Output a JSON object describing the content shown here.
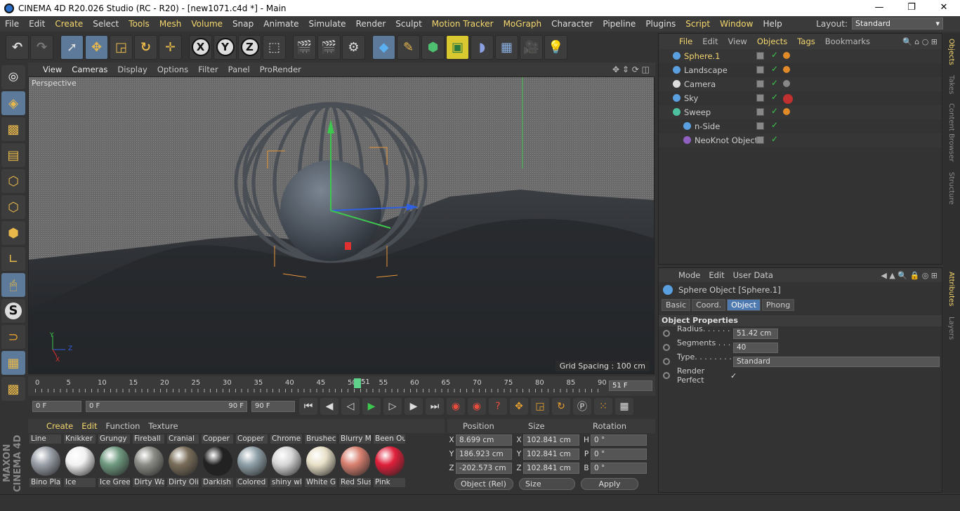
{
  "window": {
    "title": "CINEMA 4D R20.026 Studio (RC - R20) - [new1071.c4d *] - Main"
  },
  "menu": [
    "File",
    "Edit",
    "Create",
    "Select",
    "Tools",
    "Mesh",
    "Volume",
    "Snap",
    "Animate",
    "Simulate",
    "Render",
    "Sculpt",
    "Motion Tracker",
    "MoGraph",
    "Character",
    "Pipeline",
    "Plugins",
    "Script",
    "Window",
    "Help"
  ],
  "layout": {
    "label": "Layout:",
    "value": "Standard"
  },
  "toolbar": {
    "x": "X",
    "y": "Y",
    "z": "Z"
  },
  "viewport": {
    "menu": [
      "View",
      "Cameras",
      "Display",
      "Options",
      "Filter",
      "Panel",
      "ProRender"
    ],
    "label": "Perspective",
    "grid_spacing": "Grid Spacing : 100 cm",
    "axis_x": "X",
    "axis_y": "Y",
    "axis_z": "Z"
  },
  "timeline": {
    "ticks": [
      "0",
      "5",
      "10",
      "15",
      "20",
      "25",
      "30",
      "35",
      "40",
      "45",
      "50",
      "55",
      "60",
      "65",
      "70",
      "75",
      "80",
      "85",
      "90"
    ],
    "current": "51",
    "current_field": "51 F",
    "start": "0 F",
    "range_start": "0 F",
    "range_end": "90 F",
    "end": "90 F"
  },
  "materials": {
    "menu": [
      "Create",
      "Edit",
      "Function",
      "Texture"
    ],
    "top_labels": [
      "Line",
      "Knikker",
      "Grungy",
      "Fireball",
      "Cranial",
      "Copper",
      "Copper",
      "Chrome",
      "Brushec",
      "Blurry M",
      "Been Ou"
    ],
    "items": [
      {
        "name": "Bino Pla",
        "color": "#9aa0a8"
      },
      {
        "name": "Ice",
        "color": "#f2f2f2"
      },
      {
        "name": "Ice Gree",
        "color": "#6f9a80"
      },
      {
        "name": "Dirty Wa",
        "color": "#8b8b86"
      },
      {
        "name": "Dirty Oli",
        "color": "#7a6e5a"
      },
      {
        "name": "Darkish",
        "color": "#222222"
      },
      {
        "name": "Colored",
        "color": "#8fa0a8"
      },
      {
        "name": "shiny wl",
        "color": "#d7d7d7"
      },
      {
        "name": "White G",
        "color": "#e8e0c8"
      },
      {
        "name": "Red Slus",
        "color": "#d88070"
      },
      {
        "name": "Pink",
        "color": "#e0203a"
      }
    ]
  },
  "coords": {
    "headers": [
      "Position",
      "Size",
      "Rotation"
    ],
    "rows": [
      {
        "axis": "X",
        "pos": "8.699 cm",
        "saxis": "X",
        "size": "102.841 cm",
        "raxis": "H",
        "rot": "0 °"
      },
      {
        "axis": "Y",
        "pos": "186.923 cm",
        "saxis": "Y",
        "size": "102.841 cm",
        "raxis": "P",
        "rot": "0 °"
      },
      {
        "axis": "Z",
        "pos": "-202.573 cm",
        "saxis": "Z",
        "size": "102.841 cm",
        "raxis": "B",
        "rot": "0 °"
      }
    ],
    "mode": "Object (Rel)",
    "size_mode": "Size",
    "apply": "Apply"
  },
  "objects": {
    "menu": [
      "File",
      "Edit",
      "View",
      "Objects",
      "Tags",
      "Bookmarks"
    ],
    "items": [
      {
        "name": "Sphere.1",
        "color": "#5aa0e0"
      },
      {
        "name": "Landscape",
        "color": "#5aa0e0"
      },
      {
        "name": "Camera",
        "color": "#dddddd"
      },
      {
        "name": "Sky",
        "color": "#5aa0e0"
      },
      {
        "name": "Sweep",
        "color": "#4ec0a0"
      },
      {
        "name": "n-Side",
        "color": "#5aa0e0"
      },
      {
        "name": "NeoKnot Object",
        "color": "#9060c0"
      }
    ]
  },
  "sidetabs": [
    "Objects",
    "Takes",
    "Content Browser",
    "Structure",
    "Attributes",
    "Layers"
  ],
  "attributes": {
    "menu": [
      "Mode",
      "Edit",
      "User Data"
    ],
    "title": "Sphere Object [Sphere.1]",
    "tabs": [
      "Basic",
      "Coord.",
      "Object",
      "Phong"
    ],
    "section": "Object Properties",
    "props": [
      {
        "label": "Radius. . . . . . .",
        "value": "51.42 cm"
      },
      {
        "label": "Segments . . . .",
        "value": "40"
      },
      {
        "label": "Type. . . . . . . . .",
        "value": "Standard"
      },
      {
        "label": "Render Perfect",
        "value": "✓"
      }
    ]
  }
}
